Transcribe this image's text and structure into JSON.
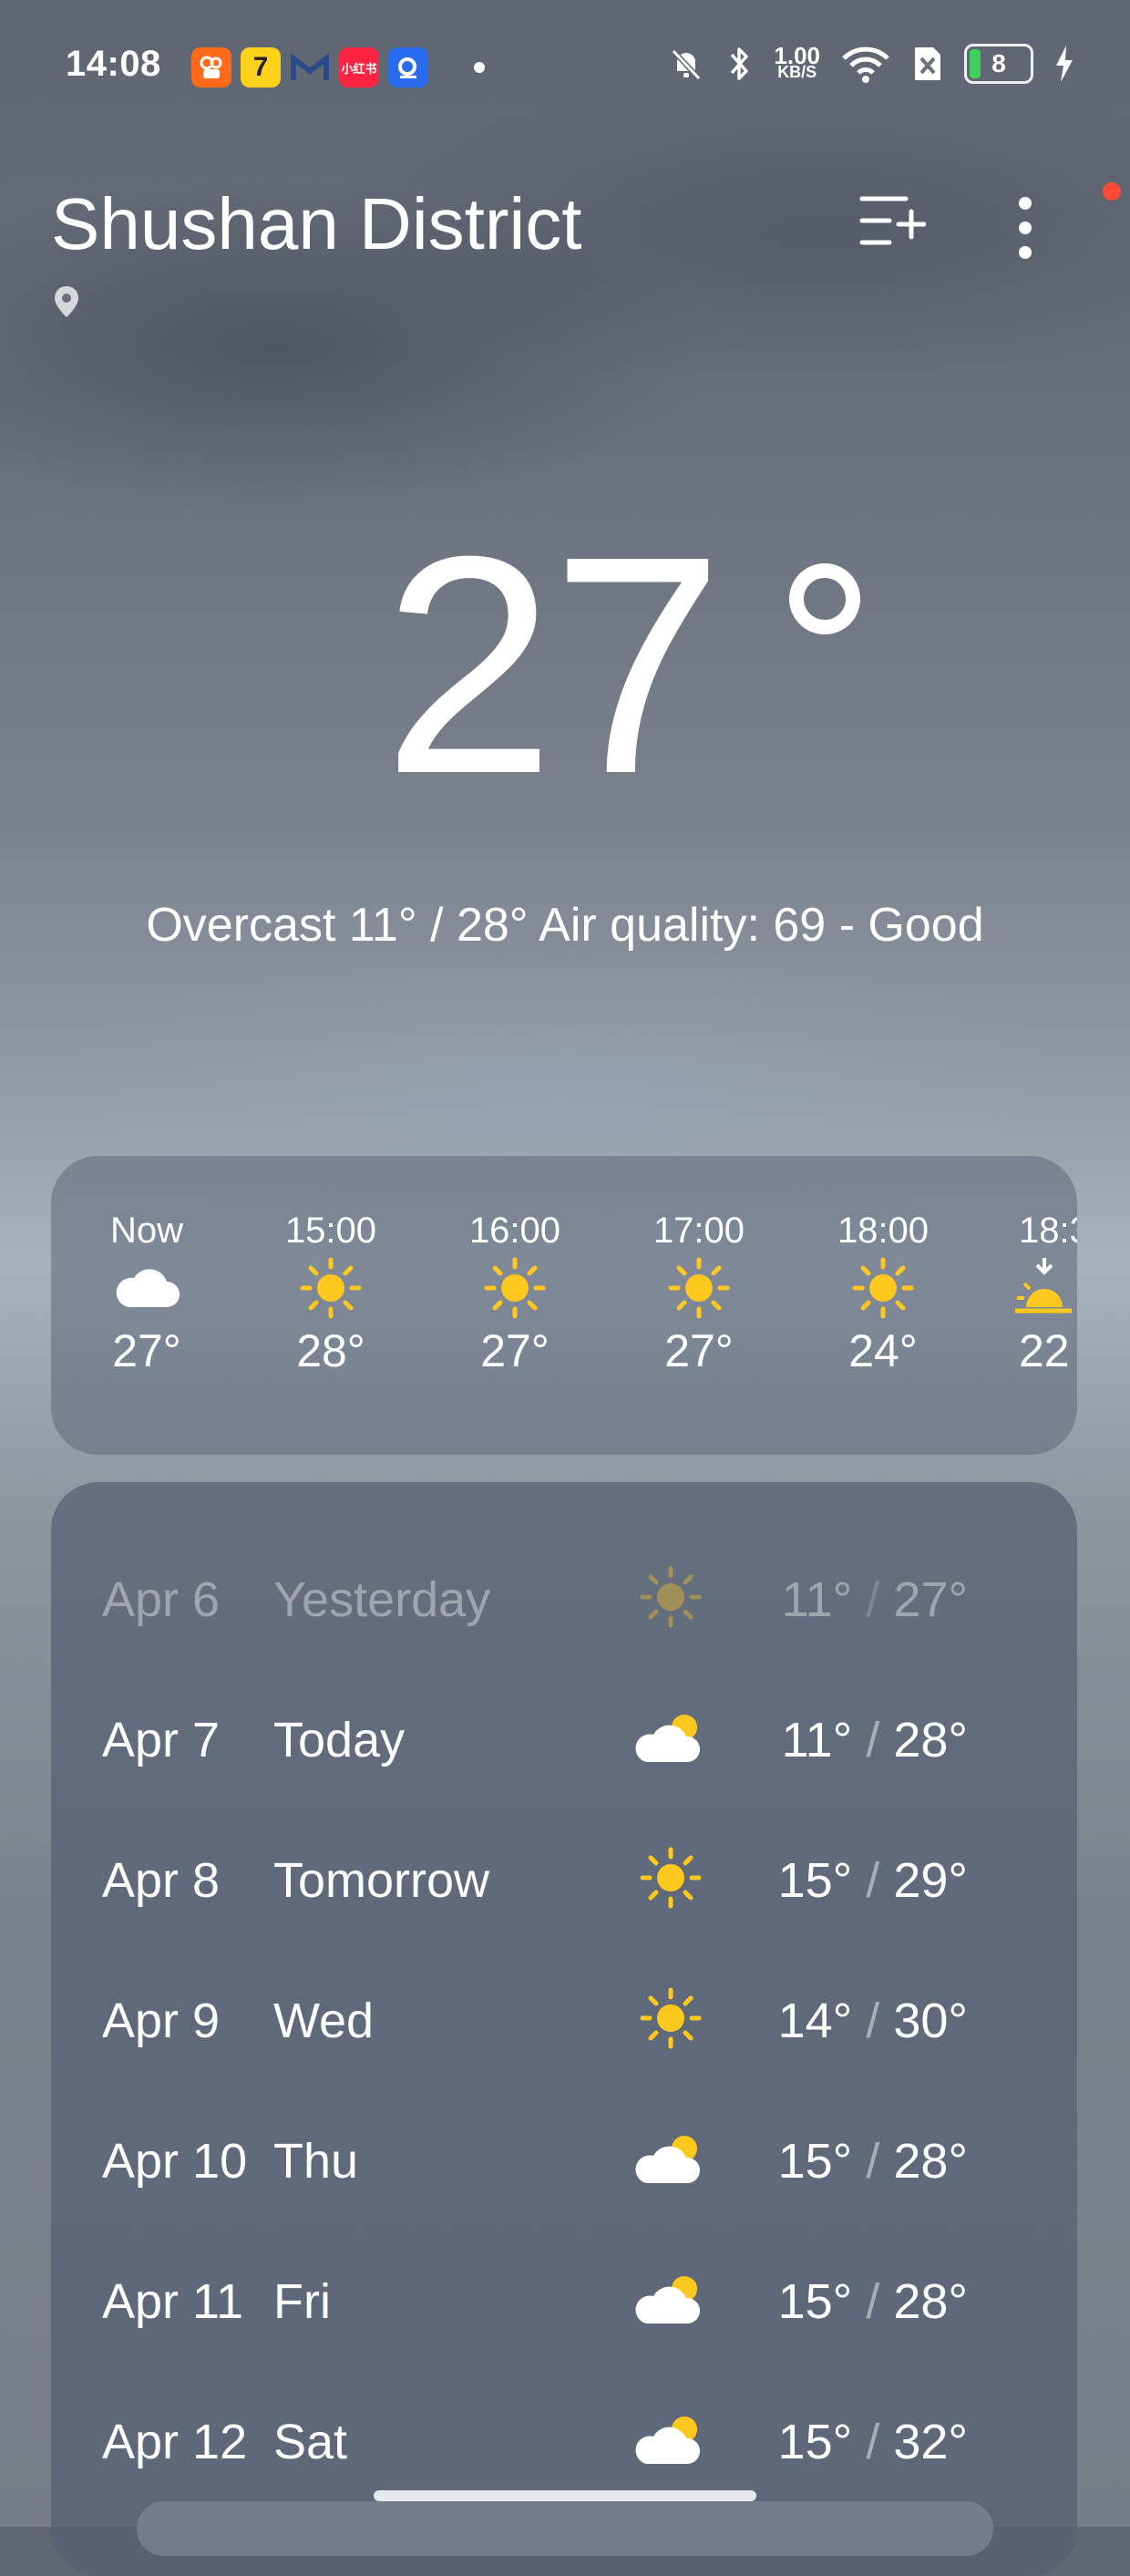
{
  "status_bar": {
    "time": "14:08",
    "apps": [
      "kuaishou",
      "qimao",
      "gmail",
      "xiaohongshu",
      "search"
    ],
    "xiaohongshu_label": "小红书",
    "net_speed_value": "1.00",
    "net_speed_unit": "KB/S",
    "battery_level": "8"
  },
  "header": {
    "city": "Shushan District"
  },
  "current": {
    "temperature": "27",
    "summary": "Overcast  11° / 28°  Air quality: 69 - Good"
  },
  "hourly": [
    {
      "time": "Now",
      "icon": "cloud-icon",
      "temp": "27°"
    },
    {
      "time": "15:00",
      "icon": "sun-icon",
      "temp": "28°"
    },
    {
      "time": "16:00",
      "icon": "sun-icon",
      "temp": "27°"
    },
    {
      "time": "17:00",
      "icon": "sun-icon",
      "temp": "27°"
    },
    {
      "time": "18:00",
      "icon": "sun-icon",
      "temp": "24°"
    },
    {
      "time": "18:3",
      "icon": "sunset-icon",
      "temp": "22"
    }
  ],
  "daily": [
    {
      "date": "Apr 6",
      "day": "Yesterday",
      "icon": "sun-icon",
      "low": "11°",
      "high": "27°",
      "past": true
    },
    {
      "date": "Apr 7",
      "day": "Today",
      "icon": "partly-cloudy-icon",
      "low": "11°",
      "high": "28°"
    },
    {
      "date": "Apr 8",
      "day": "Tomorrow",
      "icon": "sun-icon",
      "low": "15°",
      "high": "29°"
    },
    {
      "date": "Apr 9",
      "day": "Wed",
      "icon": "sun-icon",
      "low": "14°",
      "high": "30°"
    },
    {
      "date": "Apr 10",
      "day": "Thu",
      "icon": "partly-cloudy-icon",
      "low": "15°",
      "high": "28°"
    },
    {
      "date": "Apr 11",
      "day": "Fri",
      "icon": "partly-cloudy-icon",
      "low": "15°",
      "high": "28°"
    },
    {
      "date": "Apr 12",
      "day": "Sat",
      "icon": "partly-cloudy-icon",
      "low": "15°",
      "high": "32°"
    }
  ],
  "colors": {
    "sun": "#FFC81E",
    "notification_dot": "#FF4A3A",
    "battery_fill": "#3FD15A"
  }
}
